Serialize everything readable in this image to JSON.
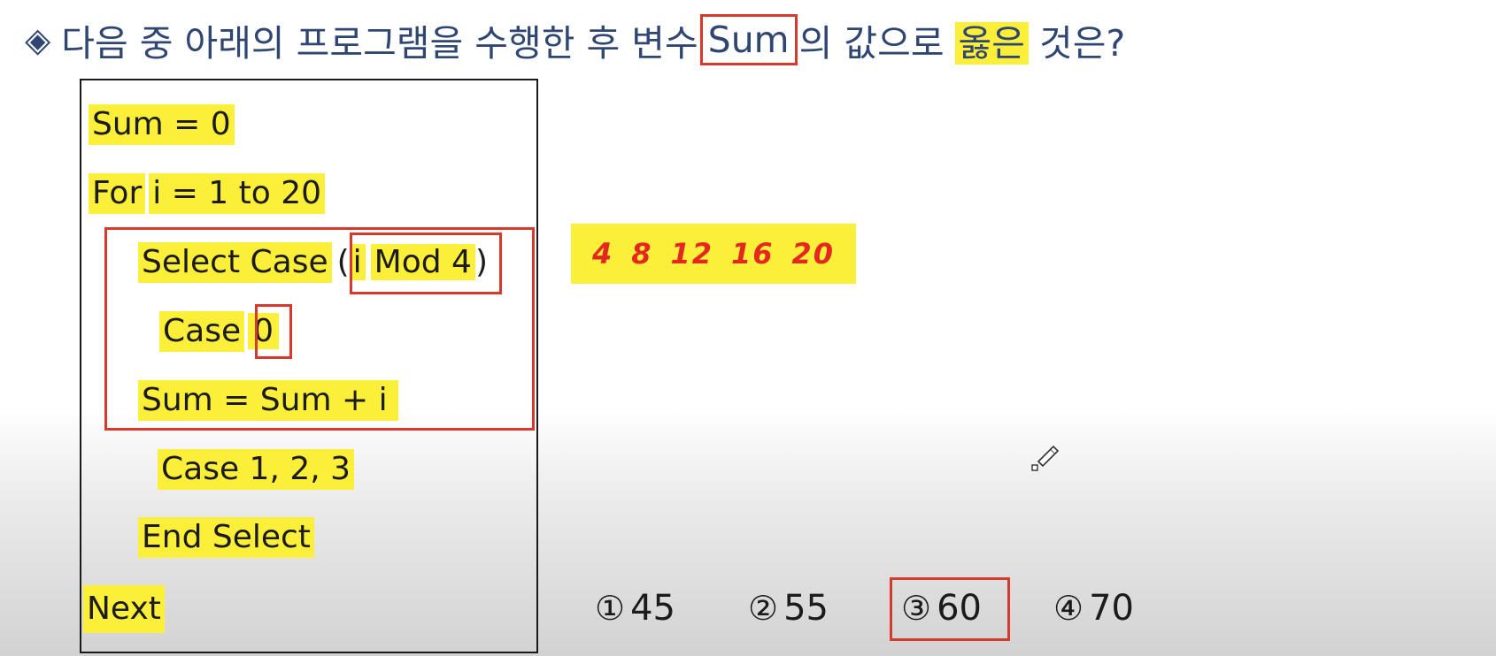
{
  "question": {
    "marker": "◈",
    "before": "다음 중 아래의 프로그램을 수행한 후 변수",
    "variable": "Sum",
    "middle": "의 값으로",
    "highlight": "옳은",
    "after": "것은?"
  },
  "code": {
    "line1": "Sum = 0",
    "line2a": "For",
    "line2b": "i = 1 to 20",
    "line3a": "Select Case",
    "line3b": "(",
    "line3c": "i",
    "line3d": "Mod 4",
    "line3e": ")",
    "line4a": "Case",
    "line4b": "0",
    "line5": "Sum = Sum  + i",
    "line6": "Case 1, 2, 3",
    "line7": "End Select",
    "line8": "Next"
  },
  "note": [
    "4",
    "8",
    "12",
    "16",
    "20"
  ],
  "choices": [
    {
      "num": "①",
      "value": "45"
    },
    {
      "num": "②",
      "value": "55"
    },
    {
      "num": "③",
      "value": "60"
    },
    {
      "num": "④",
      "value": "70"
    }
  ],
  "colors": {
    "highlight": "#fbef3a",
    "red": "#d63a2c",
    "title": "#2f4673"
  }
}
